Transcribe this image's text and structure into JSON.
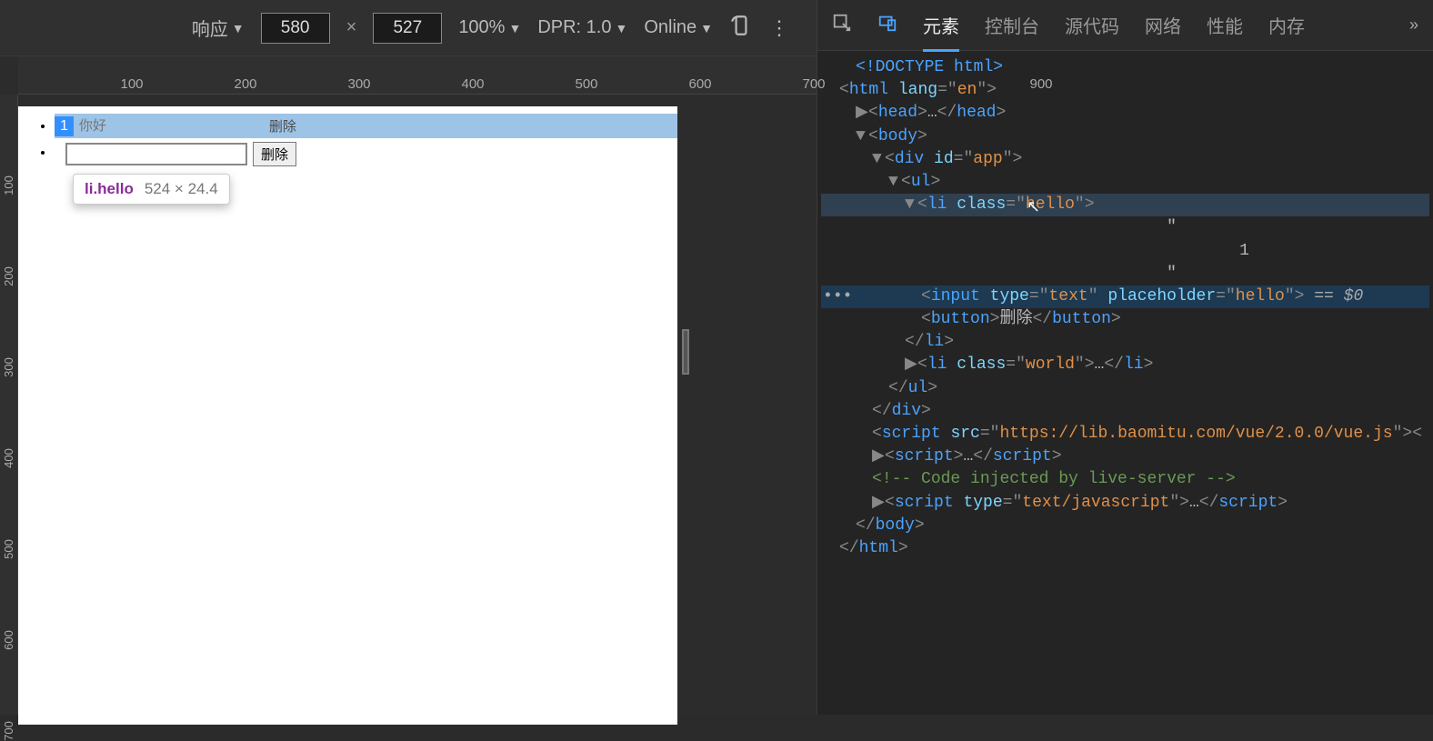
{
  "toolbar": {
    "device": "响应",
    "width": "580",
    "height": "527",
    "zoom": "100%",
    "dpr_label": "DPR: 1.0",
    "throttle": "Online"
  },
  "ruler_h": [
    "100",
    "200",
    "300",
    "400",
    "500",
    "600",
    "700",
    "900"
  ],
  "ruler_v": [
    "100",
    "200",
    "300",
    "400",
    "500",
    "600",
    "700"
  ],
  "list_items": [
    {
      "num": "1",
      "placeholder": "你好",
      "btn": "删除",
      "highlighted": true
    },
    {
      "num": "",
      "placeholder": "",
      "btn": "删除",
      "highlighted": false
    }
  ],
  "tooltip": {
    "selector": "li.hello",
    "dims": "524 × 24.4"
  },
  "devtools": {
    "tabs": [
      "元素",
      "控制台",
      "源代码",
      "网络",
      "性能",
      "内存"
    ],
    "active_tab": "元素",
    "dom": {
      "doctype": "<!DOCTYPE html>",
      "html_open": {
        "tag": "html",
        "attrs": [
          [
            "lang",
            "en"
          ]
        ]
      },
      "head": {
        "tag": "head",
        "ell": "…"
      },
      "body_open": "body",
      "div_open": {
        "tag": "div",
        "attrs": [
          [
            "id",
            "app"
          ]
        ]
      },
      "ul_open": "ul",
      "li1_open": {
        "tag": "li",
        "attrs": [
          [
            "class",
            "hello"
          ]
        ]
      },
      "li1_text_q1": "\"",
      "li1_text_val": "1",
      "li1_text_q2": "\"",
      "input": {
        "tag": "input",
        "attrs": [
          [
            "type",
            "text"
          ],
          [
            "placeholder",
            "hello"
          ]
        ],
        "suffix": " == $0"
      },
      "button": {
        "tag": "button",
        "text": "删除"
      },
      "li1_close": "li",
      "li2": {
        "tag": "li",
        "attrs": [
          [
            "class",
            "world"
          ]
        ],
        "ell": "…"
      },
      "ul_close": "ul",
      "div_close": "div",
      "script1": {
        "tag": "script",
        "attrs": [
          [
            "src",
            "https://lib.baomitu.com/vue/2.0.0/vue.js"
          ]
        ]
      },
      "script2": {
        "tag": "script",
        "ell": "…"
      },
      "comment": " Code injected by live-server ",
      "script3": {
        "tag": "script",
        "attrs": [
          [
            "type",
            "text/javascript"
          ]
        ],
        "ell": "…"
      },
      "body_close": "body",
      "html_close": "html"
    }
  }
}
